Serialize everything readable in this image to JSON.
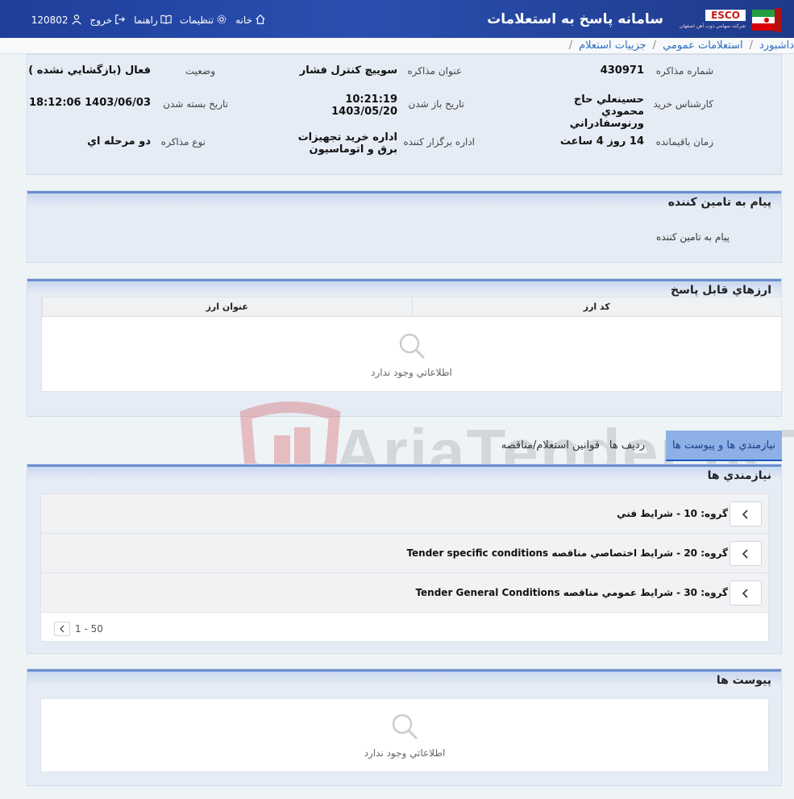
{
  "header": {
    "app_title": "سامانه پاسخ به استعلامات",
    "brand_esco": "ESCO",
    "brand_sub": "شركت سهامي ذوب آهن اصفهان",
    "nav": {
      "home": "خانه",
      "settings": "تنظيمات",
      "guide": "راهنما",
      "logout": "خروج",
      "user_id": "120802"
    }
  },
  "breadcrumb": {
    "items": [
      "داشبورد",
      "استعلامات عمومي",
      "جزييات استعلام"
    ]
  },
  "info": {
    "negotiation_number_label": "شماره مذاكره",
    "negotiation_number": "430971",
    "negotiation_title_label": "عنوان مذاكره",
    "negotiation_title": "سوييچ کنترل فشار",
    "status_label": "وضعيت",
    "status": "فعال (بازگشايي نشده )",
    "buyer_expert_label": "كارشناس خريد",
    "buyer_expert": "حسينعلي حاج محمودي ورنوسفادراني",
    "open_date_label": "تاريخ باز شدن",
    "open_time": "10:21:19",
    "open_date": "1403/05/20",
    "close_date_label": "تاريخ بسته شدن",
    "close_date": "1403/06/03 18:12:06",
    "remaining_label": "زمان باقيمانده",
    "remaining": "14 روز 4 ساعت",
    "organizer_label": "اداره برگزار كننده",
    "organizer": "اداره خريد تجهيزات برق و اتوماسيون",
    "type_label": "نوع مذاكره",
    "type": "دو مرحله اي"
  },
  "supplier_message": {
    "title": "پيام به تامين كننده",
    "body": "پيام به تامين كننده"
  },
  "currencies": {
    "title": "ارزهاي قابل پاسخ",
    "col_code": "کد ارز",
    "col_title": "عنوان ارز",
    "empty": "اطلاعاتي وجود ندارد"
  },
  "tabs": {
    "requirements": "نيازمندي ها و پيوست ها",
    "rows": "رديف ها",
    "rules": "قوانين استعلام/مناقصه"
  },
  "requirements": {
    "title": "نيازمندي ها",
    "groups": [
      "گروه: 10 - شرايط فني",
      "گروه: 20 - شرايط اختصاصي مناقصه Tender specific conditions",
      "گروه: 30 - شرايط عمومي مناقصه Tender General Conditions"
    ],
    "pager": "1 - 50"
  },
  "attachments": {
    "title": "پيوست ها",
    "empty": "اطلاعاتي وجود ندارد"
  },
  "watermark": "AriaTender.neT",
  "colors": {
    "header_bg": "#1f3f9a",
    "panel_bg": "#e6ecf5",
    "link": "#2f6fbf",
    "tab_active": "#8db0e6"
  }
}
